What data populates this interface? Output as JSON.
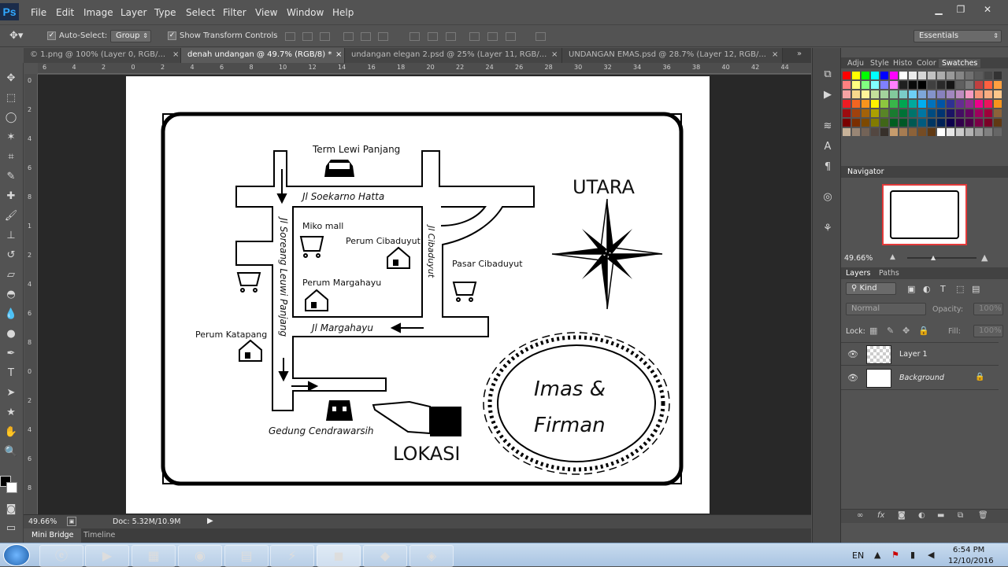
{
  "menu": {
    "logo": "Ps",
    "items": [
      "File",
      "Edit",
      "Image",
      "Layer",
      "Type",
      "Select",
      "Filter",
      "View",
      "Window",
      "Help"
    ]
  },
  "options": {
    "auto_select_label": "Auto-Select:",
    "auto_select_value": "Group",
    "show_transform_label": "Show Transform Controls",
    "workspace": "Essentials"
  },
  "tabs": [
    {
      "label": "© 1.png @ 100% (Layer 0, RGB/...",
      "close": "×"
    },
    {
      "label": "denah undangan @ 49.7% (RGB/8) *",
      "close": "×"
    },
    {
      "label": "undangan elegan 2.psd @ 25% (Layer 11, RGB/...",
      "close": "×"
    },
    {
      "label": "UNDANGAN EMAS.psd @ 28.7% (Layer 12, RGB/...",
      "close": "×"
    }
  ],
  "ruler_top": [
    "6",
    "4",
    "2",
    "0",
    "2",
    "4",
    "6",
    "8",
    "10",
    "12",
    "14",
    "16",
    "18",
    "20",
    "22",
    "24",
    "26",
    "28",
    "30",
    "32",
    "34",
    "36",
    "38",
    "40",
    "42",
    "44"
  ],
  "ruler_left": [
    "0",
    "2",
    "4",
    "6",
    "8",
    "1",
    "2",
    "4",
    "6",
    "8",
    "0",
    "2",
    "4",
    "6",
    "8"
  ],
  "map": {
    "labels": {
      "term": "Term Lewi Panjang",
      "soekarno": "Jl Soekarno Hatta",
      "miko": "Miko mall",
      "cibaduyut_perum": "Perum Cibaduyut",
      "soreang": "Jl Soreang Leuwi Panjang",
      "jl_cibaduyut": "Jl Cibaduyut",
      "pasar": "Pasar Cibaduyut",
      "margahayu_perum": "Perum Margahayu",
      "jl_margahayu": "Jl Margahayu",
      "katapang": "Perum Katapang",
      "gedung": "Gedung Cendrawarsih",
      "lokasi": "LOKASI",
      "utara": "UTARA",
      "name1": "Imas &",
      "name2": "Firman"
    }
  },
  "status": {
    "zoom": "49.66%",
    "doc": "Doc: 5.32M/10.9M"
  },
  "bottom_tabs": [
    "Mini Bridge",
    "Timeline"
  ],
  "panels": {
    "swatch_tabs": [
      "Adju",
      "Style",
      "Histo",
      "Color",
      "Swatches"
    ],
    "navigator_title": "Navigator",
    "navigator_zoom": "49.66%",
    "layers_tabs": [
      "Layers",
      "Paths"
    ],
    "kind_label": "Kind",
    "blend_mode": "Normal",
    "opacity_label": "Opacity:",
    "opacity_value": "100%",
    "lock_label": "Lock:",
    "fill_label": "Fill:",
    "fill_value": "100%",
    "layers": [
      {
        "name": "Layer 1"
      },
      {
        "name": "Background"
      }
    ]
  },
  "taskbar": {
    "lang": "EN",
    "time": "6:54 PM",
    "date": "12/10/2016"
  },
  "swatch_colors": [
    [
      "#ff0000",
      "#ffff00",
      "#00ff00",
      "#00ffff",
      "#0000ff",
      "#ff00ff",
      "#ffffff",
      "#ebebeb",
      "#d6d6d6",
      "#c2c2c2",
      "#adadad",
      "#999999",
      "#858585",
      "#707070",
      "#5c5c5c",
      "#474747",
      "#333333"
    ],
    [
      "#ff8080",
      "#ffff80",
      "#80ff80",
      "#80ffff",
      "#8080ff",
      "#ff80ff",
      "#1f1f1f",
      "#0a0a0a",
      "#000000",
      "#404040",
      "#2a2a2a",
      "#151515",
      "#606060",
      "#7a7a7a",
      "#c04040",
      "#ff6040",
      "#ffa040"
    ],
    [
      "#f5a3a3",
      "#f7d98c",
      "#fff599",
      "#c4df9b",
      "#a3d39c",
      "#82ca9c",
      "#7accc8",
      "#6dcff6",
      "#7da7d9",
      "#8393ca",
      "#8781bd",
      "#a187be",
      "#bd8cbf",
      "#f49ac2",
      "#f69679",
      "#f9ad81",
      "#fdc68a"
    ],
    [
      "#ed1c24",
      "#f26522",
      "#f7941d",
      "#fff200",
      "#8dc63f",
      "#39b54a",
      "#00a651",
      "#00a99d",
      "#00aeef",
      "#0072bc",
      "#0054a6",
      "#2e3192",
      "#662d91",
      "#92278f",
      "#ec008c",
      "#ed145b",
      "#f7941d"
    ],
    [
      "#9e0b0f",
      "#a0410d",
      "#a36209",
      "#aba000",
      "#598527",
      "#1a7b30",
      "#007236",
      "#00746b",
      "#0076a3",
      "#004b80",
      "#003471",
      "#1b1464",
      "#440e62",
      "#630460",
      "#9e005d",
      "#9e0039",
      "#8c6239"
    ],
    [
      "#790000",
      "#7b2e00",
      "#7d4900",
      "#827b00",
      "#406618",
      "#005e20",
      "#005826",
      "#005952",
      "#005b7f",
      "#003663",
      "#002157",
      "#0d004c",
      "#32004b",
      "#4b0049",
      "#7b0046",
      "#7a0026",
      "#603913"
    ],
    [
      "#c7b299",
      "#998675",
      "#736357",
      "#534741",
      "#37302a",
      "#c69c6d",
      "#a67c52",
      "#8c6239",
      "#754c24",
      "#603913",
      "#ffffff",
      "#e6e6e6",
      "#cccccc",
      "#b3b3b3",
      "#999999",
      "#808080",
      "#666666"
    ]
  ]
}
